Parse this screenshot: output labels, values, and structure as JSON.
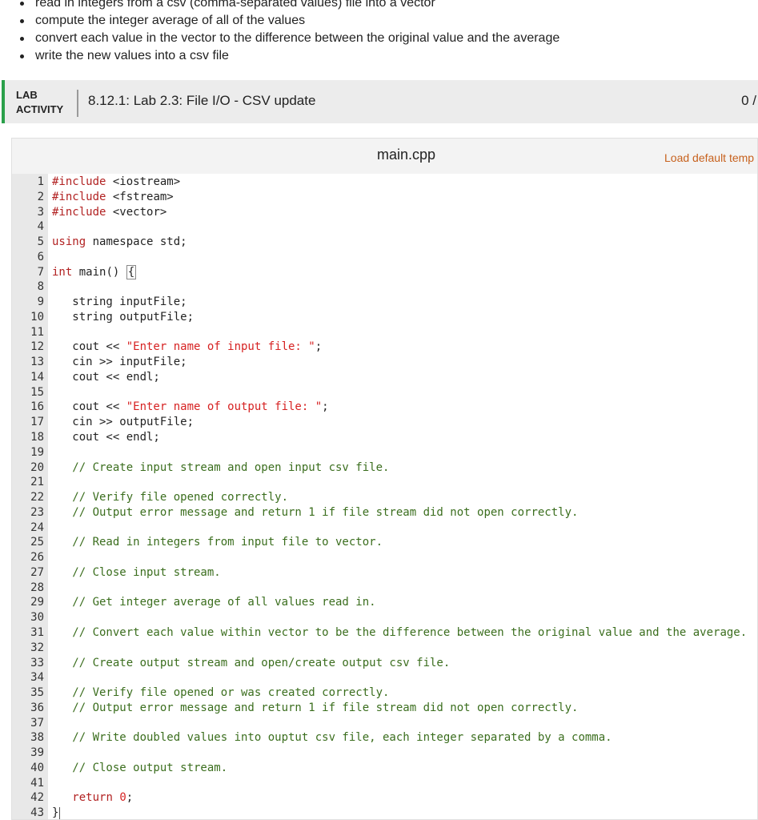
{
  "instructions": [
    "read in integers from a csv (comma-separated values) file into a vector",
    "compute the integer average of all of the values",
    "convert each value in the vector to the difference between the original value and the average",
    "write the new values into a csv file"
  ],
  "lab": {
    "tag_line1": "LAB",
    "tag_line2": "ACTIVITY",
    "title": "8.12.1: Lab 2.3: File I/O - CSV update",
    "score": "0 /"
  },
  "editor": {
    "file_name": "main.cpp",
    "load_default": "Load default temp",
    "lines": [
      {
        "n": "1",
        "parts": [
          [
            "kw",
            "#include"
          ],
          [
            "",
            " <iostream>"
          ]
        ]
      },
      {
        "n": "2",
        "parts": [
          [
            "kw",
            "#include"
          ],
          [
            "",
            " <fstream>"
          ]
        ]
      },
      {
        "n": "3",
        "parts": [
          [
            "kw",
            "#include"
          ],
          [
            "",
            " <vector>"
          ]
        ]
      },
      {
        "n": "4",
        "parts": []
      },
      {
        "n": "5",
        "parts": [
          [
            "kw",
            "using"
          ],
          [
            "",
            " namespace std;"
          ]
        ]
      },
      {
        "n": "6",
        "parts": []
      },
      {
        "n": "7",
        "parts": [
          [
            "kw",
            "int"
          ],
          [
            "",
            " main() "
          ],
          [
            "brace",
            "{"
          ]
        ]
      },
      {
        "n": "8",
        "parts": []
      },
      {
        "n": "9",
        "parts": [
          [
            "",
            "   string inputFile;"
          ]
        ]
      },
      {
        "n": "10",
        "parts": [
          [
            "",
            "   string outputFile;"
          ]
        ]
      },
      {
        "n": "11",
        "parts": []
      },
      {
        "n": "12",
        "parts": [
          [
            "",
            "   cout << "
          ],
          [
            "str",
            "\"Enter name of input file: \""
          ],
          [
            "",
            ";"
          ]
        ]
      },
      {
        "n": "13",
        "parts": [
          [
            "",
            "   cin >> inputFile;"
          ]
        ]
      },
      {
        "n": "14",
        "parts": [
          [
            "",
            "   cout << endl;"
          ]
        ]
      },
      {
        "n": "15",
        "parts": []
      },
      {
        "n": "16",
        "parts": [
          [
            "",
            "   cout << "
          ],
          [
            "str",
            "\"Enter name of output file: \""
          ],
          [
            "",
            ";"
          ]
        ]
      },
      {
        "n": "17",
        "parts": [
          [
            "",
            "   cin >> outputFile;"
          ]
        ]
      },
      {
        "n": "18",
        "parts": [
          [
            "",
            "   cout << endl;"
          ]
        ]
      },
      {
        "n": "19",
        "parts": []
      },
      {
        "n": "20",
        "parts": [
          [
            "cm",
            "   // Create input stream and open input csv file."
          ]
        ]
      },
      {
        "n": "21",
        "parts": []
      },
      {
        "n": "22",
        "parts": [
          [
            "cm",
            "   // Verify file opened correctly."
          ]
        ]
      },
      {
        "n": "23",
        "parts": [
          [
            "cm",
            "   // Output error message and return 1 if file stream did not open correctly."
          ]
        ]
      },
      {
        "n": "24",
        "parts": []
      },
      {
        "n": "25",
        "parts": [
          [
            "cm",
            "   // Read in integers from input file to vector."
          ]
        ]
      },
      {
        "n": "26",
        "parts": []
      },
      {
        "n": "27",
        "parts": [
          [
            "cm",
            "   // Close input stream."
          ]
        ]
      },
      {
        "n": "28",
        "parts": []
      },
      {
        "n": "29",
        "parts": [
          [
            "cm",
            "   // Get integer average of all values read in."
          ]
        ]
      },
      {
        "n": "30",
        "parts": []
      },
      {
        "n": "31",
        "parts": [
          [
            "cm",
            "   // Convert each value within vector to be the difference between the original value and the average."
          ]
        ]
      },
      {
        "n": "32",
        "parts": []
      },
      {
        "n": "33",
        "parts": [
          [
            "cm",
            "   // Create output stream and open/create output csv file."
          ]
        ]
      },
      {
        "n": "34",
        "parts": []
      },
      {
        "n": "35",
        "parts": [
          [
            "cm",
            "   // Verify file opened or was created correctly."
          ]
        ]
      },
      {
        "n": "36",
        "parts": [
          [
            "cm",
            "   // Output error message and return 1 if file stream did not open correctly."
          ]
        ]
      },
      {
        "n": "37",
        "parts": []
      },
      {
        "n": "38",
        "parts": [
          [
            "cm",
            "   // Write doubled values into ouptut csv file, each integer separated by a comma."
          ]
        ]
      },
      {
        "n": "39",
        "parts": []
      },
      {
        "n": "40",
        "parts": [
          [
            "cm",
            "   // Close output stream."
          ]
        ]
      },
      {
        "n": "41",
        "parts": []
      },
      {
        "n": "42",
        "parts": [
          [
            "",
            "   "
          ],
          [
            "kw",
            "return"
          ],
          [
            "",
            " "
          ],
          [
            "num",
            "0"
          ],
          [
            "",
            ";"
          ]
        ]
      },
      {
        "n": "43",
        "parts": [
          [
            "",
            "}"
          ],
          [
            "cursor",
            ""
          ]
        ]
      }
    ]
  }
}
